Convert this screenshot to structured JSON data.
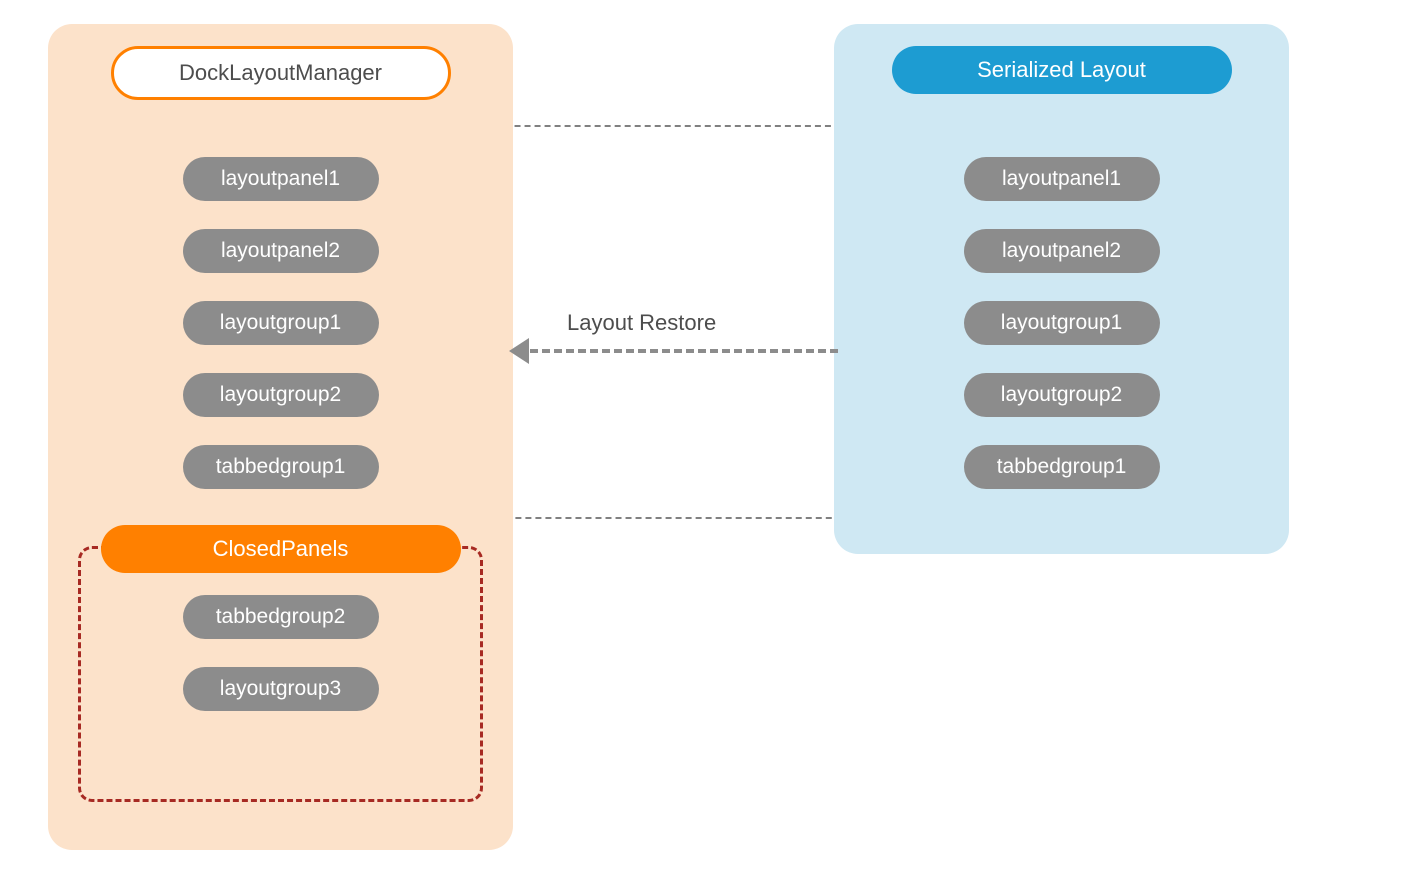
{
  "left": {
    "title": "DockLayoutManager",
    "items": [
      "layoutpanel1",
      "layoutpanel2",
      "layoutgroup1",
      "layoutgroup2",
      "tabbedgroup1"
    ],
    "closed_panels": {
      "title": "ClosedPanels",
      "items": [
        "tabbedgroup2",
        "layoutgroup3"
      ]
    }
  },
  "right": {
    "title": "Serialized Layout",
    "items": [
      "layoutpanel1",
      "layoutpanel2",
      "layoutgroup1",
      "layoutgroup2",
      "tabbedgroup1"
    ]
  },
  "arrow_label": "Layout Restore"
}
